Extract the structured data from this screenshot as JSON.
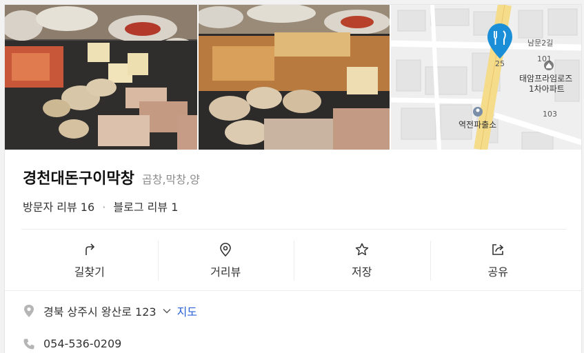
{
  "place": {
    "name": "경천대돈구이막창",
    "category": "곱창,막창,양"
  },
  "reviews": {
    "visitor": "방문자 리뷰 16",
    "separator": "·",
    "blog": "블로그 리뷰 1"
  },
  "actions": [
    {
      "label": "길찾기",
      "icon": "directions-icon"
    },
    {
      "label": "거리뷰",
      "icon": "location-pin-icon"
    },
    {
      "label": "저장",
      "icon": "star-icon"
    },
    {
      "label": "공유",
      "icon": "share-icon"
    }
  ],
  "address": {
    "text": "경북 상주시 왕산로 123",
    "map_link": "지도"
  },
  "phone": "054-536-0209",
  "map": {
    "labels": {
      "street": "남문2길",
      "num_101": "101",
      "num_25": "25",
      "num_103": "103",
      "apartment_line1": "태암프라임로즈",
      "apartment_line2": "1차아파트",
      "police": "역전파출소"
    },
    "marker_color": "#1a8fd8",
    "road_color": "#f5dc8a"
  },
  "colors": {
    "link": "#2a5fd6",
    "muted": "#8a8a8a"
  }
}
